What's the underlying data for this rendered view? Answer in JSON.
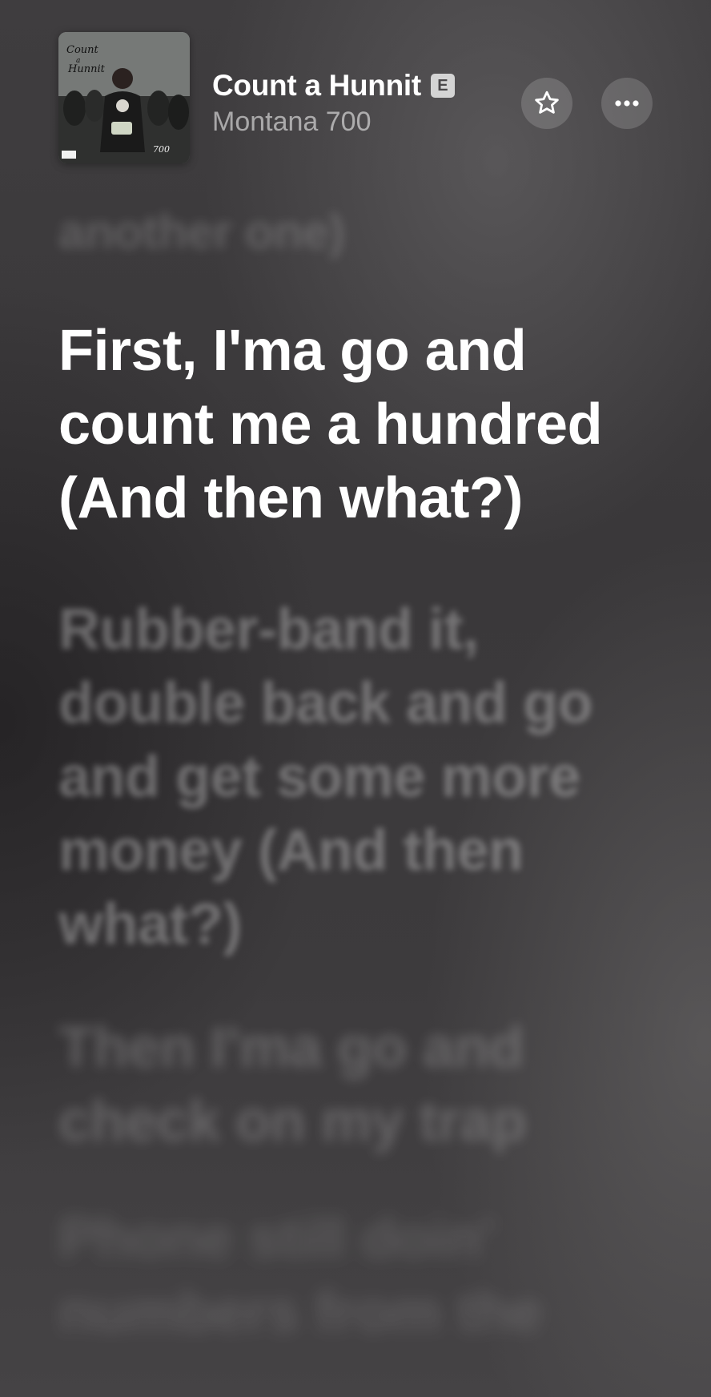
{
  "now_playing": {
    "title": "Count a Hunnit",
    "explicit_badge": "E",
    "artist": "Montana 700",
    "artwork_icon": "album-artwork"
  },
  "controls": {
    "favorite_icon": "star-icon",
    "more_icon": "ellipsis-icon"
  },
  "lyrics": {
    "previous": "another one)",
    "current": "First, I'ma go and count me a hundred (And then what?)",
    "upcoming": [
      "Rubber-band it, double back and go and get some more money (And then what?)",
      "Then I'ma go and check on my trap",
      "Phone still doin' numbers from the"
    ]
  },
  "colors": {
    "background": "#3b393b",
    "text_active": "#ffffff",
    "text_inactive": "rgba(255,255,255,0.30)"
  }
}
